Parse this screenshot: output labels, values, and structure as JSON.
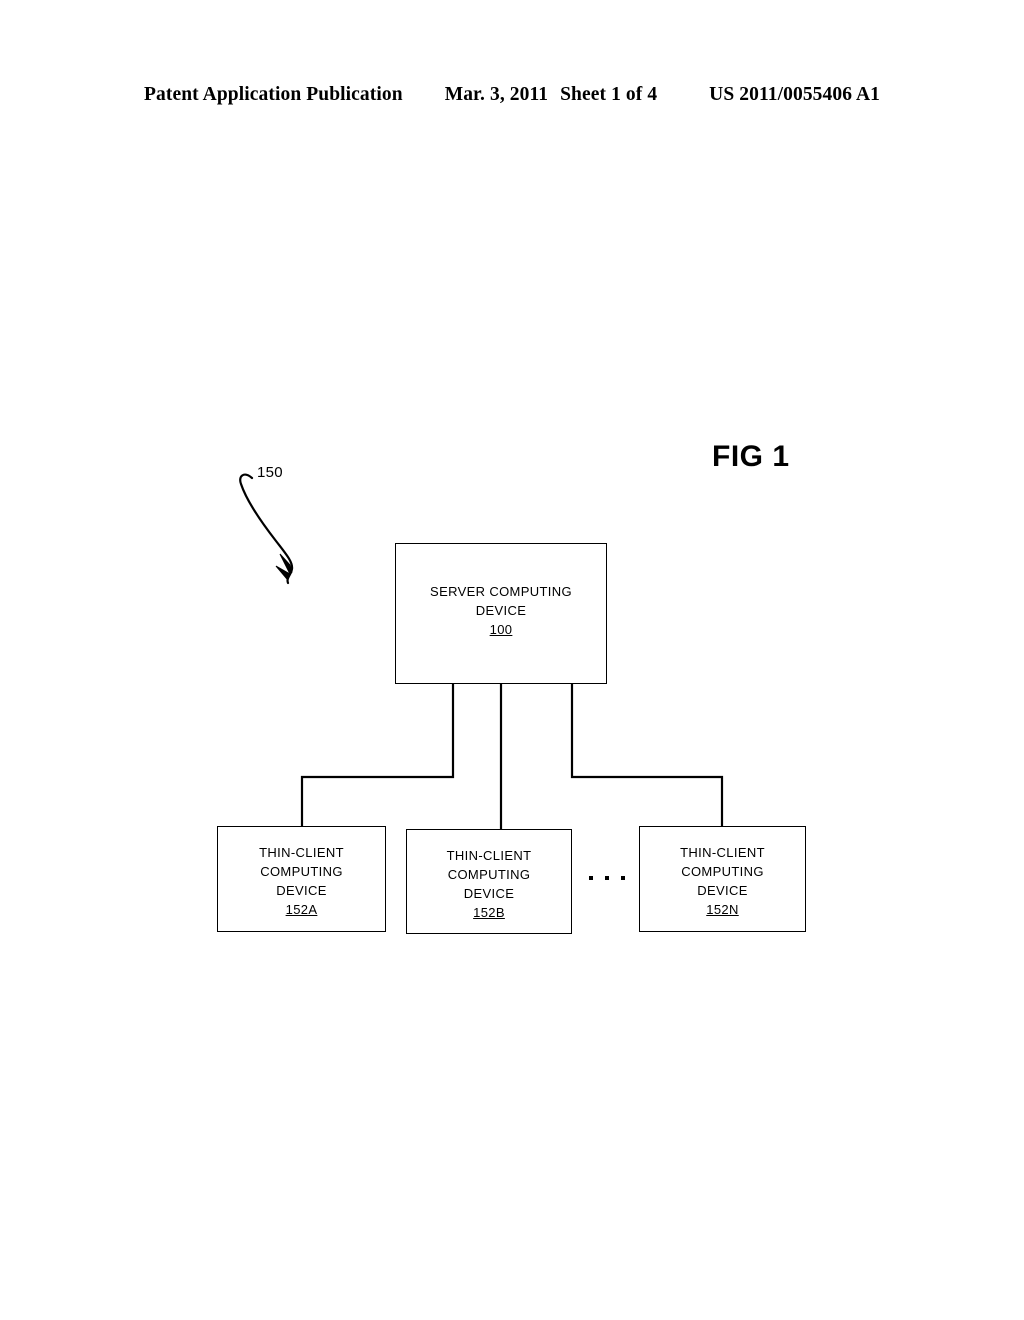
{
  "header": {
    "publication": "Patent Application Publication",
    "date": "Mar. 3, 2011",
    "sheet": "Sheet 1 of 4",
    "document_number": "US 2011/0055406 A1"
  },
  "figure": {
    "title": "FIG 1",
    "system_reference": "150",
    "ellipsis": "· · ·",
    "line_color": "#000000",
    "background_color": "#ffffff",
    "nodes": {
      "server": {
        "line1": "SERVER COMPUTING",
        "line2": "DEVICE",
        "ref": "100"
      },
      "client_a": {
        "line1": "THIN-CLIENT",
        "line2": "COMPUTING",
        "line3": "DEVICE",
        "ref": "152A"
      },
      "client_b": {
        "line1": "THIN-CLIENT",
        "line2": "COMPUTING",
        "line3": "DEVICE",
        "ref": "152B"
      },
      "client_c": {
        "line1": "THIN-CLIENT",
        "line2": "COMPUTING",
        "line3": "DEVICE",
        "ref": "152N"
      }
    }
  }
}
